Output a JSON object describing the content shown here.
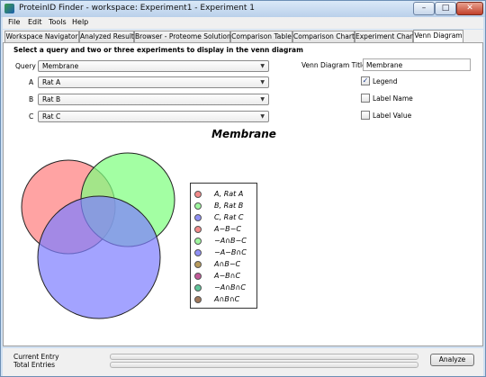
{
  "window": {
    "title": "ProteinID Finder - workspace: Experiment1 - Experiment 1",
    "minimize_glyph": "–",
    "maximize_glyph": "□",
    "close_glyph": "✕"
  },
  "menu": [
    "File",
    "Edit",
    "Tools",
    "Help"
  ],
  "tabs": [
    {
      "label": "Workspace Navigator",
      "active": false
    },
    {
      "label": "Analyzed Result",
      "active": false
    },
    {
      "label": "Browser - Proteome Solutions",
      "active": false
    },
    {
      "label": "Comparison Table",
      "active": false
    },
    {
      "label": "Comparison Chart",
      "active": false
    },
    {
      "label": "Experiment Chart",
      "active": false
    },
    {
      "label": "Venn Diagram",
      "active": true
    }
  ],
  "form": {
    "instruction": "Select a query and two or three experiments to display in the venn diagram",
    "query_label": "Query",
    "query_value": "Membrane",
    "a_label": "A",
    "a_value": "Rat A",
    "b_label": "B",
    "b_value": "Rat B",
    "c_label": "C",
    "c_value": "Rat C",
    "dropdown_arrow": "▼",
    "venn_title_label": "Venn Diagram Title",
    "venn_title_value": "Membrane",
    "legend_label": "Legend",
    "legend_checked": true,
    "label_name_label": "Label Name",
    "label_name_checked": false,
    "label_value_label": "Label Value",
    "label_value_checked": false
  },
  "venn": {
    "title": "Membrane",
    "sets": [
      {
        "name": "A, Rat A",
        "color": "#ff8080"
      },
      {
        "name": "B, Rat B",
        "color": "#80ff80"
      },
      {
        "name": "C, Rat C",
        "color": "#8080ff"
      }
    ],
    "legend": [
      {
        "label": "A, Rat A",
        "color": "#f28a8a"
      },
      {
        "label": "B, Rat B",
        "color": "#9ef79e"
      },
      {
        "label": "C, Rat C",
        "color": "#8f8ff5"
      },
      {
        "label": "A−B−C",
        "color": "#f28a8a"
      },
      {
        "label": "−A∩B−C",
        "color": "#9ef79e"
      },
      {
        "label": "−A−B∩C",
        "color": "#8f8ff5"
      },
      {
        "label": "A∩B−C",
        "color": "#b79a5c"
      },
      {
        "label": "A−B∩C",
        "color": "#c25a98"
      },
      {
        "label": "−A∩B∩C",
        "color": "#5fc49a"
      },
      {
        "label": "A∩B∩C",
        "color": "#a0785a"
      }
    ]
  },
  "status": {
    "current_entry_label": "Current Entry",
    "total_entries_label": "Total Entries",
    "analyze_label": "Analyze"
  }
}
